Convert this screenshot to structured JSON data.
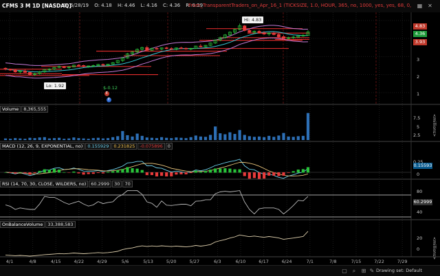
{
  "header": {
    "symbol": "CFMS 3 M 1D [NASDAQ]",
    "date": "D: 6/28/19",
    "open": "O: 4.18",
    "high": "H: 4.46",
    "low": "L: 4.16",
    "close": "C: 4.36",
    "range": "R: 0.29",
    "study": "From_TransparentTraders_on_Apr_16_1 (TICKSIZE, 1.0, HOUR, 365, no, 1000, yes, yes, 68, 0, 0, no,..."
  },
  "price_panel": {
    "y_ticks": [
      "5",
      "4",
      "3",
      "2",
      "1"
    ],
    "price_tags": [
      {
        "text": "4.83",
        "color": "#c0392b"
      },
      {
        "text": "4.36",
        "color": "#1f9b3b"
      },
      {
        "text": "3.93",
        "color": "#c0392b"
      }
    ],
    "hi_label": "Hi: 4.83",
    "lo_label": "Lo: 1.92",
    "dividend_label": "$-0.12",
    "event_markers": [
      "E",
      "E"
    ]
  },
  "volume_panel": {
    "label": "Volume",
    "value": "8,365,555",
    "y_ticks": [
      "7.5",
      "5",
      "2.5"
    ],
    "unit": "<millions>"
  },
  "macd_panel": {
    "label": "MACD (12, 26, 9, EXPONENTIAL, no)",
    "value": "0.155929",
    "avg": "0.231825",
    "diff": "-0.075896",
    "zero": "0",
    "y_ticks": [
      "0.25",
      "0"
    ],
    "tag": "0.15593"
  },
  "rsi_panel": {
    "label": "RSI (14, 70, 30, CLOSE, WILDERS, no)",
    "value": "60.2999",
    "ob": "30",
    "os": "70",
    "y_ticks": [
      "80",
      "40"
    ],
    "tag": "60.2999"
  },
  "obv_panel": {
    "label": "OnBalanceVolume",
    "value": "33,388,583",
    "y_ticks": [
      "20",
      "0"
    ],
    "unit": "<millions>"
  },
  "x_axis": [
    "4/1",
    "4/8",
    "4/15",
    "4/22",
    "4/29",
    "5/6",
    "5/13",
    "5/20",
    "5/27",
    "6/3",
    "6/10",
    "6/17",
    "6/24",
    "7/1",
    "7/8",
    "7/15",
    "7/22",
    "7/29"
  ],
  "footer": {
    "drawing_set": "Drawing set: Default"
  },
  "colors": {
    "bull": "#29c23a",
    "bear": "#e83b3b",
    "band": "#c47ad6",
    "ma": "#35c9d6",
    "level": "#d62a2a",
    "volume": "#2d6fb5"
  },
  "chart_data": {
    "type": "candlestick",
    "x_dates": [
      "4/1",
      "4/2",
      "4/3",
      "4/4",
      "4/5",
      "4/8",
      "4/9",
      "4/10",
      "4/11",
      "4/12",
      "4/15",
      "4/16",
      "4/17",
      "4/18",
      "4/22",
      "4/23",
      "4/24",
      "4/25",
      "4/26",
      "4/29",
      "4/30",
      "5/1",
      "5/2",
      "5/3",
      "5/6",
      "5/7",
      "5/8",
      "5/9",
      "5/10",
      "5/13",
      "5/14",
      "5/15",
      "5/16",
      "5/17",
      "5/20",
      "5/21",
      "5/22",
      "5/23",
      "5/24",
      "5/28",
      "5/29",
      "5/30",
      "5/31",
      "6/3",
      "6/4",
      "6/5",
      "6/6",
      "6/7",
      "6/10",
      "6/11",
      "6/12",
      "6/13",
      "6/14",
      "6/17",
      "6/18",
      "6/19",
      "6/20",
      "6/21",
      "6/24",
      "6/25",
      "6/26",
      "6/27",
      "6/28"
    ],
    "ohlc": [
      [
        2.35,
        2.4,
        2.24,
        2.3
      ],
      [
        2.3,
        2.33,
        2.2,
        2.25
      ],
      [
        2.25,
        2.3,
        2.1,
        2.15
      ],
      [
        2.15,
        2.25,
        2.05,
        2.2
      ],
      [
        2.2,
        2.28,
        2.1,
        2.12
      ],
      [
        2.12,
        2.15,
        1.95,
        2.0
      ],
      [
        2.0,
        2.1,
        1.92,
        2.05
      ],
      [
        2.05,
        2.2,
        2.0,
        2.15
      ],
      [
        2.15,
        2.3,
        2.1,
        2.28
      ],
      [
        2.28,
        2.35,
        2.2,
        2.3
      ],
      [
        2.3,
        2.42,
        2.25,
        2.4
      ],
      [
        2.4,
        2.5,
        2.35,
        2.45
      ],
      [
        2.45,
        2.48,
        2.35,
        2.38
      ],
      [
        2.38,
        2.45,
        2.3,
        2.42
      ],
      [
        2.42,
        2.55,
        2.4,
        2.52
      ],
      [
        2.52,
        2.58,
        2.45,
        2.5
      ],
      [
        2.5,
        2.55,
        2.4,
        2.45
      ],
      [
        2.45,
        2.5,
        2.38,
        2.48
      ],
      [
        2.48,
        2.55,
        2.42,
        2.5
      ],
      [
        2.5,
        2.6,
        2.45,
        2.56
      ],
      [
        2.56,
        2.62,
        2.48,
        2.52
      ],
      [
        2.52,
        2.6,
        2.45,
        2.58
      ],
      [
        2.58,
        2.7,
        2.55,
        2.66
      ],
      [
        2.66,
        2.8,
        2.62,
        2.78
      ],
      [
        2.78,
        2.95,
        2.7,
        2.92
      ],
      [
        2.92,
        3.2,
        2.88,
        3.15
      ],
      [
        3.15,
        3.3,
        3.05,
        3.25
      ],
      [
        3.25,
        3.45,
        3.2,
        3.4
      ],
      [
        3.4,
        3.55,
        3.3,
        3.5
      ],
      [
        3.5,
        3.6,
        3.3,
        3.35
      ],
      [
        3.35,
        3.5,
        3.3,
        3.45
      ],
      [
        3.45,
        3.55,
        3.38,
        3.42
      ],
      [
        3.42,
        3.5,
        3.35,
        3.48
      ],
      [
        3.48,
        3.55,
        3.4,
        3.44
      ],
      [
        3.44,
        3.52,
        3.38,
        3.4
      ],
      [
        3.4,
        3.5,
        3.35,
        3.48
      ],
      [
        3.48,
        3.55,
        3.42,
        3.46
      ],
      [
        3.46,
        3.5,
        3.38,
        3.42
      ],
      [
        3.42,
        3.48,
        3.35,
        3.45
      ],
      [
        3.45,
        3.6,
        3.42,
        3.58
      ],
      [
        3.58,
        3.7,
        3.5,
        3.55
      ],
      [
        3.55,
        3.65,
        3.48,
        3.62
      ],
      [
        3.62,
        3.78,
        3.58,
        3.75
      ],
      [
        3.75,
        3.95,
        3.7,
        3.92
      ],
      [
        3.92,
        4.1,
        3.85,
        4.05
      ],
      [
        4.05,
        4.25,
        4.0,
        4.2
      ],
      [
        4.2,
        4.4,
        4.15,
        4.35
      ],
      [
        4.35,
        4.55,
        4.25,
        4.5
      ],
      [
        4.5,
        4.83,
        4.45,
        4.7
      ],
      [
        4.7,
        4.75,
        4.4,
        4.45
      ],
      [
        4.45,
        4.55,
        4.3,
        4.35
      ],
      [
        4.35,
        4.45,
        4.25,
        4.4
      ],
      [
        4.4,
        4.48,
        4.28,
        4.32
      ],
      [
        4.32,
        4.4,
        4.2,
        4.25
      ],
      [
        4.25,
        4.35,
        4.15,
        4.3
      ],
      [
        4.3,
        4.38,
        4.18,
        4.22
      ],
      [
        4.22,
        4.3,
        4.05,
        4.1
      ],
      [
        4.1,
        4.2,
        3.93,
        4.0
      ],
      [
        4.0,
        4.1,
        3.95,
        4.05
      ],
      [
        4.05,
        4.15,
        3.98,
        4.08
      ],
      [
        4.08,
        4.2,
        4.02,
        4.15
      ],
      [
        4.15,
        4.25,
        4.1,
        4.18
      ],
      [
        4.18,
        4.46,
        4.16,
        4.36
      ]
    ],
    "volume_millions": [
      0.5,
      0.4,
      0.6,
      0.5,
      0.4,
      0.7,
      0.6,
      0.8,
      0.9,
      0.5,
      0.6,
      0.7,
      0.4,
      0.5,
      0.8,
      0.6,
      0.5,
      0.4,
      0.6,
      0.7,
      0.5,
      0.6,
      0.9,
      1.2,
      2.8,
      1.5,
      1.1,
      2.0,
      1.3,
      0.8,
      0.7,
      0.6,
      0.9,
      0.7,
      0.6,
      0.8,
      0.7,
      0.6,
      0.9,
      1.4,
      1.1,
      1.0,
      1.6,
      4.2,
      2.1,
      1.8,
      2.4,
      1.9,
      3.1,
      1.6,
      1.2,
      1.0,
      1.1,
      0.9,
      1.3,
      1.0,
      1.4,
      2.2,
      1.1,
      1.0,
      1.2,
      1.3,
      8.37
    ],
    "ylim_price": [
      0.5,
      5.3
    ],
    "ylim_volume": [
      0,
      8.5
    ]
  }
}
